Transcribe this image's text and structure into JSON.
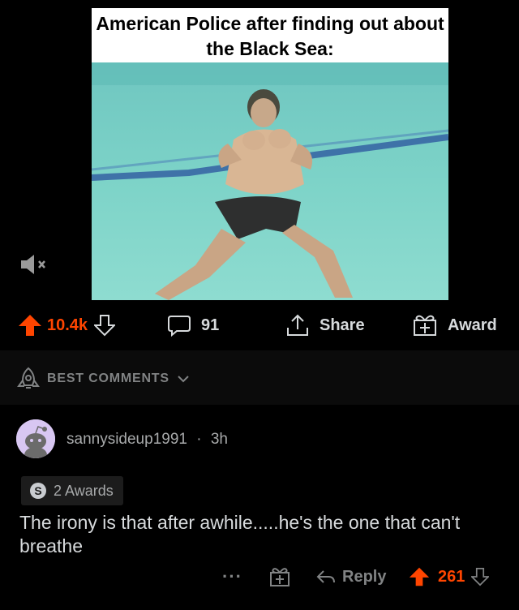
{
  "post": {
    "caption": "American Police after finding out about the Black Sea:",
    "media_icon": "mute-icon"
  },
  "actions": {
    "upvote_icon": "upvote-arrow-icon",
    "score": "10.4k",
    "downvote_icon": "downvote-arrow-icon",
    "comments_icon": "comment-bubble-icon",
    "comments_count": "91",
    "share_icon": "share-icon",
    "share_label": "Share",
    "award_icon": "gift-icon",
    "award_label": "Award"
  },
  "sort": {
    "icon": "rocket-icon",
    "label": "BEST COMMENTS",
    "chevron": "chevron-down-icon"
  },
  "comment": {
    "username": "sannysideup1991",
    "separator": "·",
    "age": "3h",
    "awards_label": "2 Awards",
    "awards_icon": "silver-award-icon",
    "body": "The irony is that after awhile.....he's the one that can't breathe",
    "more_label": "···",
    "reply_label": "Reply",
    "score": "261"
  },
  "colors": {
    "accent": "#ff4500",
    "background": "#000000",
    "text": "#d7dadc",
    "muted": "#818384"
  }
}
